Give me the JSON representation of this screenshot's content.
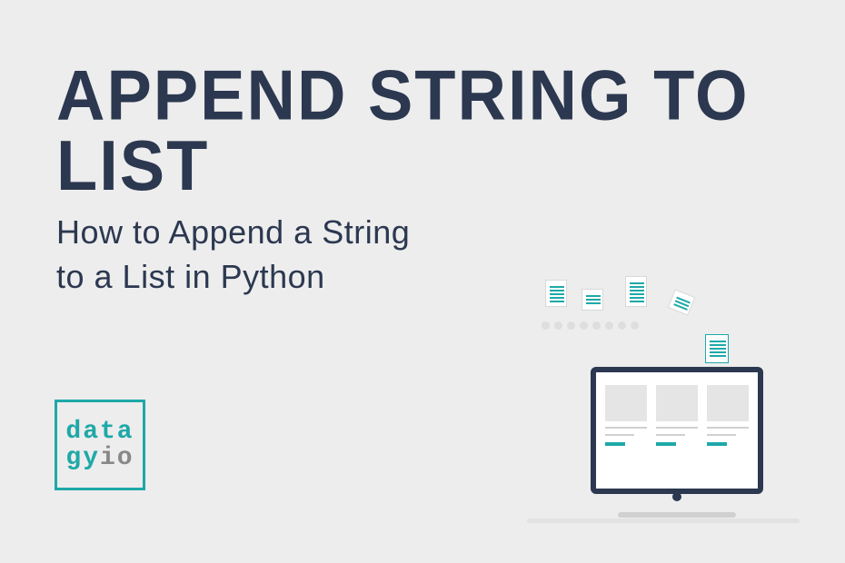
{
  "title": "APPEND STRING TO LIST",
  "subtitle_line1": "How to Append a String",
  "subtitle_line2": "to a List in Python",
  "logo": {
    "line1": "data",
    "line2_a": "gy",
    "line2_b": "io"
  }
}
